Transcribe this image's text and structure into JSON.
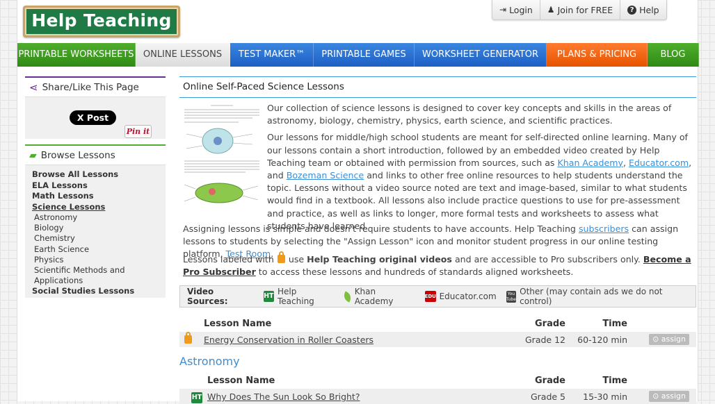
{
  "brand": {
    "logo_text": "Help Teaching"
  },
  "top_buttons": [
    {
      "label": "Login",
      "icon": "login-icon"
    },
    {
      "label": "Join for FREE",
      "icon": "person-icon"
    },
    {
      "label": "Help",
      "icon": "question-circle-icon"
    }
  ],
  "nav": [
    {
      "label": "PRINTABLE WORKSHEETS",
      "style": "green"
    },
    {
      "label": "ONLINE LESSONS",
      "style": "active"
    },
    {
      "label": "TEST MAKER™",
      "style": "blue"
    },
    {
      "label": "PRINTABLE GAMES",
      "style": "blue"
    },
    {
      "label": "WORKSHEET GENERATOR",
      "style": "blue"
    },
    {
      "label": "PLANS & PRICING",
      "style": "orange"
    },
    {
      "label": "BLOG",
      "style": "green"
    }
  ],
  "sidebar": {
    "share_title": "Share/Like This Page",
    "x_post_label": "X Post",
    "pin_label": "Pin it",
    "browse_title": "Browse Lessons",
    "categories": {
      "all": "Browse All Lessons",
      "ela": "ELA Lessons",
      "math": "Math Lessons",
      "science": "Science Lessons",
      "science_subs": [
        "Astronomy",
        "Biology",
        "Chemistry",
        "Earth Science",
        "Physics",
        "Scientific Methods and Applications"
      ],
      "social": "Social Studies Lessons"
    }
  },
  "main": {
    "title": "Online Self-Paced Science Lessons",
    "intro_p1": "Our collection of science lessons is designed to cover key concepts and skills in the areas of astronomy, biology, chemistry, physics, earth science, and scientific practices.",
    "intro_p2_a": "Our lessons for middle/high school students are meant for self-directed online learning. Many of our lessons contain a short introduction, followed by an embedded video created by Help Teaching team or obtained with permission from sources, such as ",
    "link_khan": "Khan Academy",
    "sep1": ", ",
    "link_educator": "Educator.com",
    "sep2": ", and ",
    "link_bozeman": "Bozeman Science",
    "intro_p2_b": " and links to other free online resources to help students understand the topic. Lessons without a video source noted are text and image-based, similar to what students would find in a textbook. All lessons also include practice questions to use for pre-assessment and practice, as well as links to longer, more formal tests and worksheets to assess what students have learned.",
    "assign_a": "Assigning lessons is simple and doesn't require students to have accounts. Help Teaching ",
    "link_subscribers": "subscribers",
    "assign_b": " can assign lessons to students by selecting the \"Assign Lesson\" icon and monitor student progress in our online testing platform, ",
    "link_testroom": "Test Room",
    "assign_c": ".",
    "locked_a": "Lessons labeled with ",
    "locked_b": " use ",
    "locked_bold": "Help Teaching original videos",
    "locked_c": " and are accessible to Pro subscribers only. ",
    "link_pro": "Become a Pro Subscriber",
    "locked_d": " to access these lessons and hundreds of standards aligned worksheets."
  },
  "video_sources": {
    "label": "Video Sources:",
    "items": [
      "Help Teaching",
      "Khan Academy",
      "Educator.com",
      "Other (may contain ads we do not control)"
    ],
    "ht_badge": "HT",
    "edu_badge": "EDU",
    "yt_badge": "You Tube"
  },
  "table_headers": {
    "name": "Lesson Name",
    "grade": "Grade",
    "time": "Time"
  },
  "featured_lesson": {
    "name": "Energy Conservation in Roller Coasters",
    "grade": "Grade 12",
    "time": "60-120 min",
    "assign": "assign"
  },
  "astronomy": {
    "title": "Astronomy",
    "lesson": {
      "name": "Why Does The Sun Look So Bright?",
      "grade": "Grade 5",
      "time": "15-30 min",
      "assign": "assign",
      "badge": "HT"
    }
  }
}
